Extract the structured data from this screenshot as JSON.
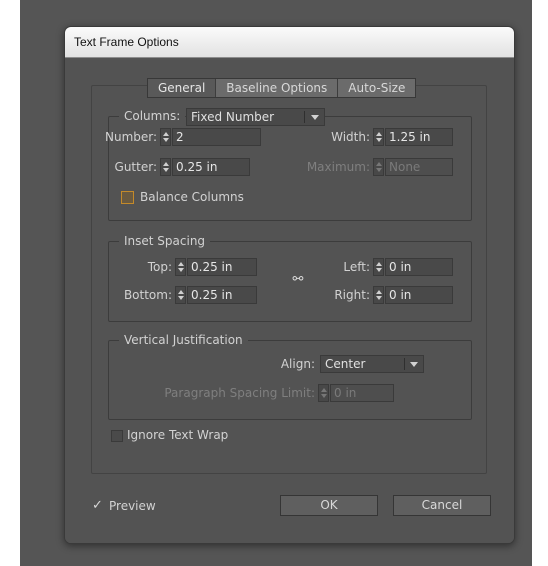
{
  "window": {
    "title": "Text Frame Options"
  },
  "tabs": [
    {
      "label": "General",
      "active": true
    },
    {
      "label": "Baseline Options",
      "active": false
    },
    {
      "label": "Auto-Size",
      "active": false
    }
  ],
  "columns": {
    "label": "Columns:",
    "type_value": "Fixed Number",
    "number_label": "Number:",
    "number_value": "2",
    "width_label": "Width:",
    "width_value": "1.25 in",
    "gutter_label": "Gutter:",
    "gutter_value": "0.25 in",
    "maximum_label": "Maximum:",
    "maximum_value": "None",
    "balance_label": "Balance Columns",
    "balance_checked": false
  },
  "inset": {
    "label": "Inset Spacing",
    "top_label": "Top:",
    "top_value": "0.25 in",
    "bottom_label": "Bottom:",
    "bottom_value": "0.25 in",
    "left_label": "Left:",
    "left_value": "0 in",
    "right_label": "Right:",
    "right_value": "0 in",
    "chain_icon": "link-chain-icon"
  },
  "vertical": {
    "label": "Vertical Justification",
    "align_label": "Align:",
    "align_value": "Center",
    "para_label": "Paragraph Spacing Limit:",
    "para_value": "0 in"
  },
  "ignore_wrap": {
    "label": "Ignore Text Wrap",
    "checked": false
  },
  "footer": {
    "preview_label": "Preview",
    "preview_checked": true,
    "preview_check_glyph": "✓",
    "ok_label": "OK",
    "cancel_label": "Cancel"
  },
  "colors": {
    "dialog_bg": "#535353",
    "focus_orange": "#c48a2a",
    "title_bar": "#f0f0f0"
  }
}
